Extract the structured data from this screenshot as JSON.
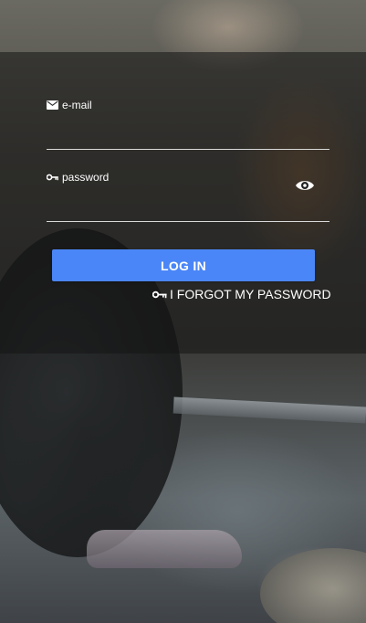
{
  "form": {
    "email": {
      "label": "e-mail",
      "value": "",
      "icon": "mail-icon"
    },
    "password": {
      "label": "password",
      "value": "",
      "icon": "key-icon",
      "toggle_icon": "eye-icon"
    },
    "login_label": "LOG IN",
    "forgot_label": "I FORGOT MY PASSWORD",
    "forgot_icon": "key-icon"
  },
  "colors": {
    "accent": "#4a86f7",
    "overlay": "rgba(20,20,20,0.55)",
    "text": "#ffffff",
    "underline": "#d9d9d9"
  }
}
